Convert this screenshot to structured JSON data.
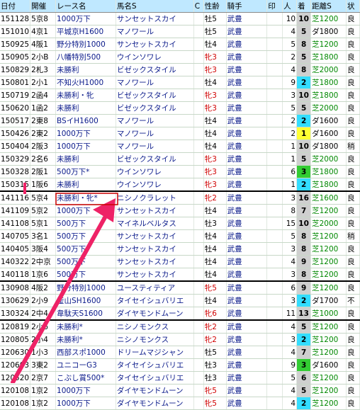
{
  "headers": [
    "日付",
    "開催",
    "レース名",
    "馬名S",
    "C",
    "性齢",
    "騎手",
    "印",
    "人",
    "着",
    "距離S",
    "状"
  ],
  "rows": [
    {
      "date": "151128",
      "place": "5京8",
      "race": "1000万下",
      "horse": "サンセットスカイ",
      "c": "",
      "age": "牡5",
      "jockey": "武豊",
      "mark": "",
      "pop": "10",
      "fin": "10",
      "dist": "芝1200",
      "cond": "良",
      "sep": false
    },
    {
      "date": "151010",
      "place": "4京1",
      "race": "平城京H1600",
      "horse": "マノワール",
      "c": "",
      "age": "牡5",
      "jockey": "武豊",
      "mark": "",
      "pop": "4",
      "fin": "5",
      "dist": "ダ1800",
      "cond": "良",
      "sep": false
    },
    {
      "date": "150925",
      "place": "4阪1",
      "race": "野分特別1000",
      "horse": "サンセットスカイ",
      "c": "",
      "age": "牡4",
      "jockey": "武豊",
      "mark": "",
      "pop": "5",
      "fin": "8",
      "dist": "芝1200",
      "cond": "良",
      "sep": false
    },
    {
      "date": "150905",
      "place": "2小B",
      "race": "八幡特別500",
      "horse": "ウインソワレ",
      "c": "",
      "age": "牝3",
      "jockey": "武豊",
      "mark": "",
      "pop": "2",
      "fin": "5",
      "dist": "芝1800",
      "cond": "良",
      "sep": false
    },
    {
      "date": "150829",
      "place": "2札3",
      "race": "未勝利",
      "horse": "ビゼックスタイル",
      "c": "",
      "age": "牝3",
      "jockey": "武豊",
      "mark": "",
      "pop": "4",
      "fin": "8",
      "dist": "芝2000",
      "cond": "良",
      "sep": false
    },
    {
      "date": "150801",
      "place": "2小1",
      "race": "不知火H1000",
      "horse": "マノワール",
      "c": "",
      "age": "牡4",
      "jockey": "武豊",
      "mark": "",
      "pop": "9",
      "fin": "2",
      "dist": "芝1800",
      "cond": "良",
      "sep": false
    },
    {
      "date": "150719",
      "place": "2函4",
      "race": "未勝利・牝",
      "horse": "ビゼックスタイル",
      "c": "",
      "age": "牝3",
      "jockey": "武豊",
      "mark": "",
      "pop": "3",
      "fin": "10",
      "dist": "芝1800",
      "cond": "良",
      "sep": false
    },
    {
      "date": "150620",
      "place": "1函2",
      "race": "未勝利",
      "horse": "ビゼックスタイル",
      "c": "",
      "age": "牝3",
      "jockey": "武豊",
      "mark": "",
      "pop": "5",
      "fin": "5",
      "dist": "芝2000",
      "cond": "良",
      "sep": false
    },
    {
      "date": "150517",
      "place": "2東8",
      "race": "BSイH1600",
      "horse": "マノワール",
      "c": "",
      "age": "牡4",
      "jockey": "武豊",
      "mark": "",
      "pop": "2",
      "fin": "2",
      "dist": "ダ1600",
      "cond": "良",
      "sep": false
    },
    {
      "date": "150426",
      "place": "2東2",
      "race": "1000万下",
      "horse": "マノワール",
      "c": "",
      "age": "牡4",
      "jockey": "武豊",
      "mark": "",
      "pop": "2",
      "fin": "1",
      "dist": "ダ1600",
      "cond": "良",
      "sep": false
    },
    {
      "date": "150404",
      "place": "2阪3",
      "race": "1000万下",
      "horse": "マノワール",
      "c": "",
      "age": "牡4",
      "jockey": "武豊",
      "mark": "",
      "pop": "1",
      "fin": "10",
      "dist": "ダ1800",
      "cond": "稍",
      "sep": false
    },
    {
      "date": "150329",
      "place": "2名6",
      "race": "未勝利",
      "horse": "ビゼックスタイル",
      "c": "",
      "age": "牝3",
      "jockey": "武豊",
      "mark": "",
      "pop": "1",
      "fin": "5",
      "dist": "芝2000",
      "cond": "良",
      "sep": false
    },
    {
      "date": "150328",
      "place": "2阪1",
      "race": "500万下*",
      "horse": "ウインソワレ",
      "c": "",
      "age": "牝3",
      "jockey": "武豊",
      "mark": "",
      "pop": "6",
      "fin": "3",
      "dist": "芝1800",
      "cond": "良",
      "sep": false
    },
    {
      "date": "150315",
      "place": "1阪6",
      "race": "未勝利",
      "horse": "ウインソワレ",
      "c": "",
      "age": "牝3",
      "jockey": "武豊",
      "mark": "",
      "pop": "1",
      "fin": "2",
      "dist": "芝1800",
      "cond": "良",
      "sep": false
    },
    {
      "date": "141116",
      "place": "5京4",
      "race": "未勝利・牝*",
      "horse": "ニシノクラレット",
      "c": "",
      "age": "牝2",
      "jockey": "武豊",
      "mark": "",
      "pop": "3",
      "fin": "16",
      "dist": "芝1600",
      "cond": "良",
      "sep": true
    },
    {
      "date": "141109",
      "place": "5京2",
      "race": "1000万下",
      "horse": "サンセットスカイ",
      "c": "",
      "age": "牡4",
      "jockey": "武豊",
      "mark": "",
      "pop": "8",
      "fin": "7",
      "dist": "芝1200",
      "cond": "良",
      "sep": false
    },
    {
      "date": "141108",
      "place": "5京1",
      "race": "500万下",
      "horse": "マイネルベルタス",
      "c": "",
      "age": "牡3",
      "jockey": "武豊",
      "mark": "",
      "pop": "15",
      "fin": "10",
      "dist": "芝2000",
      "cond": "良",
      "sep": false
    },
    {
      "date": "140705",
      "place": "3名1",
      "race": "500万下",
      "horse": "サンセットスカイ",
      "c": "",
      "age": "牡4",
      "jockey": "武豊",
      "mark": "",
      "pop": "5",
      "fin": "8",
      "dist": "芝1200",
      "cond": "稍",
      "sep": false
    },
    {
      "date": "140405",
      "place": "3阪4",
      "race": "500万下",
      "horse": "サンセットスカイ",
      "c": "",
      "age": "牡4",
      "jockey": "武豊",
      "mark": "",
      "pop": "3",
      "fin": "8",
      "dist": "芝1200",
      "cond": "良",
      "sep": false
    },
    {
      "date": "140322",
      "place": "2中京",
      "race": "500万下",
      "horse": "サンセットスカイ",
      "c": "",
      "age": "牡4",
      "jockey": "武豊",
      "mark": "",
      "pop": "4",
      "fin": "9",
      "dist": "芝1200",
      "cond": "良",
      "sep": false
    },
    {
      "date": "140118",
      "place": "1京6",
      "race": "500万下",
      "horse": "サンセットスカイ",
      "c": "",
      "age": "牡4",
      "jockey": "武豊",
      "mark": "",
      "pop": "3",
      "fin": "8",
      "dist": "芝1200",
      "cond": "良",
      "sep": false
    },
    {
      "date": "130908",
      "place": "4阪2",
      "race": "野分特別1000",
      "horse": "ユースティティア",
      "c": "",
      "age": "牝5",
      "jockey": "武豊",
      "mark": "",
      "pop": "6",
      "fin": "9",
      "dist": "芝1200",
      "cond": "良",
      "sep": true
    },
    {
      "date": "130629",
      "place": "2小9",
      "race": "釜山SH1600",
      "horse": "タイセイシュバリエ",
      "c": "",
      "age": "牡4",
      "jockey": "武豊",
      "mark": "",
      "pop": "3",
      "fin": "2",
      "dist": "ダ1700",
      "cond": "不",
      "sep": false
    },
    {
      "date": "130324",
      "place": "2中4",
      "race": "韋駄天S1600",
      "horse": "ダイヤモンドムーン",
      "c": "",
      "age": "牝6",
      "jockey": "武豊",
      "mark": "",
      "pop": "11",
      "fin": "13",
      "dist": "芝1000",
      "cond": "良",
      "sep": false
    },
    {
      "date": "120819",
      "place": "2小6",
      "race": "未勝利*",
      "horse": "ニシノモンクス",
      "c": "",
      "age": "牝2",
      "jockey": "武豊",
      "mark": "",
      "pop": "4",
      "fin": "5",
      "dist": "芝1200",
      "cond": "良",
      "sep": true
    },
    {
      "date": "120805",
      "place": "2小4",
      "race": "未勝利*",
      "horse": "ニシノモンクス",
      "c": "",
      "age": "牝2",
      "jockey": "武豊",
      "mark": "",
      "pop": "3",
      "fin": "2",
      "dist": "芝1200",
      "cond": "良",
      "sep": false
    },
    {
      "date": "120630",
      "place": "1小3",
      "race": "西部スポ1000",
      "horse": "ドリームマジシャン",
      "c": "",
      "age": "牡5",
      "jockey": "武豊",
      "mark": "",
      "pop": "4",
      "fin": "7",
      "dist": "芝1200",
      "cond": "良",
      "sep": false
    },
    {
      "date": "120603",
      "place": "3東2",
      "race": "ユニコーG3",
      "horse": "タイセイシュバリエ",
      "c": "",
      "age": "牡3",
      "jockey": "武豊",
      "mark": "",
      "pop": "9",
      "fin": "3",
      "dist": "ダ1600",
      "cond": "良",
      "sep": false
    },
    {
      "date": "120520",
      "place": "2京7",
      "race": "こぶし賞500*",
      "horse": "タイセイシュバリエ",
      "c": "",
      "age": "牡3",
      "jockey": "武豊",
      "mark": "",
      "pop": "5",
      "fin": "6",
      "dist": "芝1200",
      "cond": "良",
      "sep": false
    },
    {
      "date": "120108",
      "place": "1京2",
      "race": "1000万下",
      "horse": "ダイヤモンドムーン",
      "c": "",
      "age": "牝5",
      "jockey": "武豊",
      "mark": "",
      "pop": "4",
      "fin": "5",
      "dist": "芝1200",
      "cond": "良",
      "sep": false
    },
    {
      "date": "120108",
      "place": "1京2",
      "race": "1000万下",
      "horse": "ダイヤモンドムーン",
      "c": "",
      "age": "牝5",
      "jockey": "武豊",
      "mark": "",
      "pop": "4",
      "fin": "2",
      "dist": "芝1200",
      "cond": "良",
      "sep": false
    }
  ],
  "colors": {
    "header_bg": "#bfe8ff",
    "win": "#ffff33",
    "place2": "#33ddff",
    "place3": "#33cc33",
    "other": "#cfcfcf",
    "arrow": "#ee2266"
  }
}
